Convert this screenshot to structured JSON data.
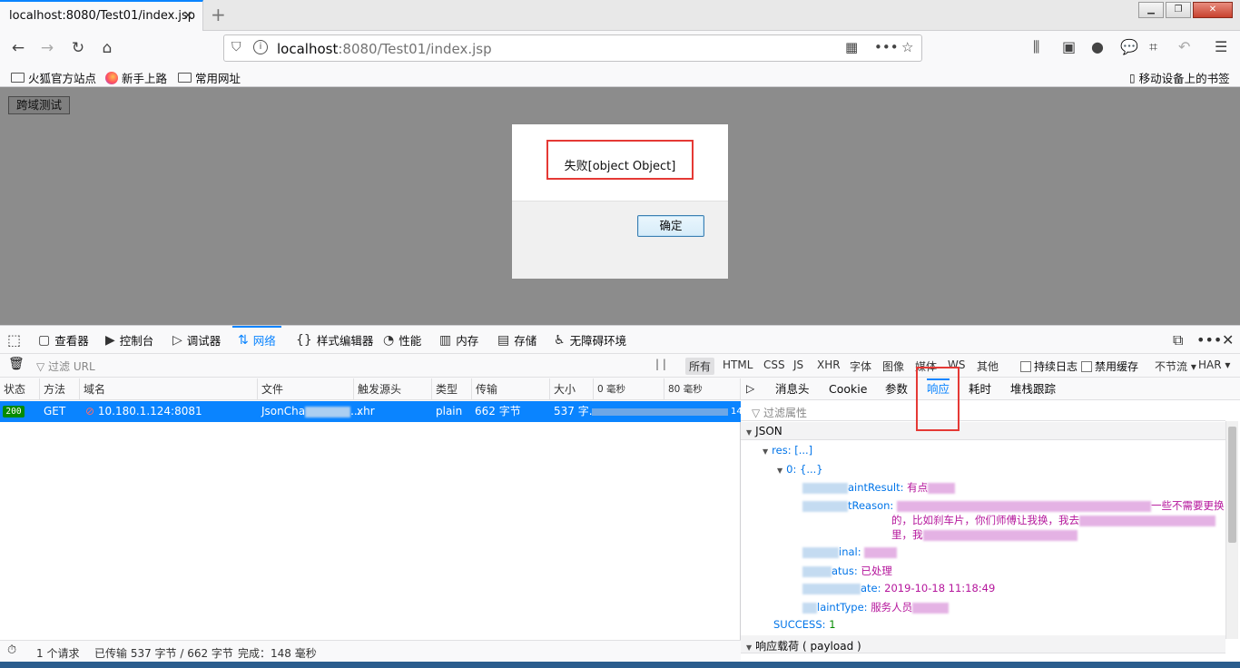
{
  "browser": {
    "tab_title": "localhost:8080/Test01/index.jsp",
    "tab_close": "×",
    "new_tab": "+",
    "url_host": "localhost",
    "url_rest": ":8080/Test01/index.jsp",
    "bookmarks": [
      "火狐官方站点",
      "新手上路",
      "常用网址"
    ],
    "mobile_bookmarks": "移动设备上的书签"
  },
  "page": {
    "button": "跨域测试",
    "alert_message": "失败[object Object]",
    "alert_ok": "确定"
  },
  "devtools": {
    "tabs": [
      "查看器",
      "控制台",
      "调试器",
      "网络",
      "样式编辑器",
      "性能",
      "内存",
      "存储",
      "无障碍环境"
    ],
    "filter_placeholder": "过滤 URL",
    "types": [
      "所有",
      "HTML",
      "CSS",
      "JS",
      "XHR",
      "字体",
      "图像",
      "媒体",
      "WS",
      "其他"
    ],
    "persist_logs": "持续日志",
    "disable_cache": "禁用缓存",
    "throttle": "不节流 ▾",
    "har": "HAR ▾",
    "columns": [
      "状态",
      "方法",
      "域名",
      "文件",
      "触发源头",
      "类型",
      "传输",
      "大小",
      "0 毫秒",
      "80 毫秒"
    ],
    "request": {
      "status": "200",
      "method": "GET",
      "domain": "10.180.1.124:8081",
      "file": "JsonCha",
      "file_suffix": "...",
      "cause": "xhr",
      "type": "plain",
      "transferred": "662 字节",
      "size": "537 字...",
      "timing_tail": "14"
    },
    "status_bar": {
      "requests": "1 个请求",
      "transferred": "已传输 537 字节 / 662 字节",
      "finish": "完成：148 毫秒"
    },
    "side_tabs": [
      "消息头",
      "Cookie",
      "参数",
      "响应",
      "耗时",
      "堆栈跟踪"
    ],
    "side_filter": "过滤属性",
    "json_section": "JSON",
    "payload_section": "响应载荷 ( payload )",
    "tree": {
      "res": "res: [...]",
      "item0": "0: {...}",
      "complaint_result_key": "aintResult:",
      "complaint_result_val": "有点",
      "complaint_reason_key": "tReason:",
      "complaint_reason_val1": "一些不需要更换",
      "complaint_reason_val2": "的，比如刹车片，你们师傅让我换，我去",
      "complaint_reason_val3": "里，我",
      "nal_key": "inal:",
      "status_key": "atus:",
      "status_val": "已处理",
      "date_key": "ate:",
      "date_val": "2019-10-18 11:18:49",
      "type_key": "laintType:",
      "type_val": "服务人员",
      "success_key": "SUCCESS:",
      "success_val": "1"
    }
  },
  "colors": {
    "accent": "#0a84ff",
    "highlight_box": "#e53935",
    "status_ok": "#058b00",
    "json_key": "#0074e8",
    "json_value": "#b5169c"
  }
}
